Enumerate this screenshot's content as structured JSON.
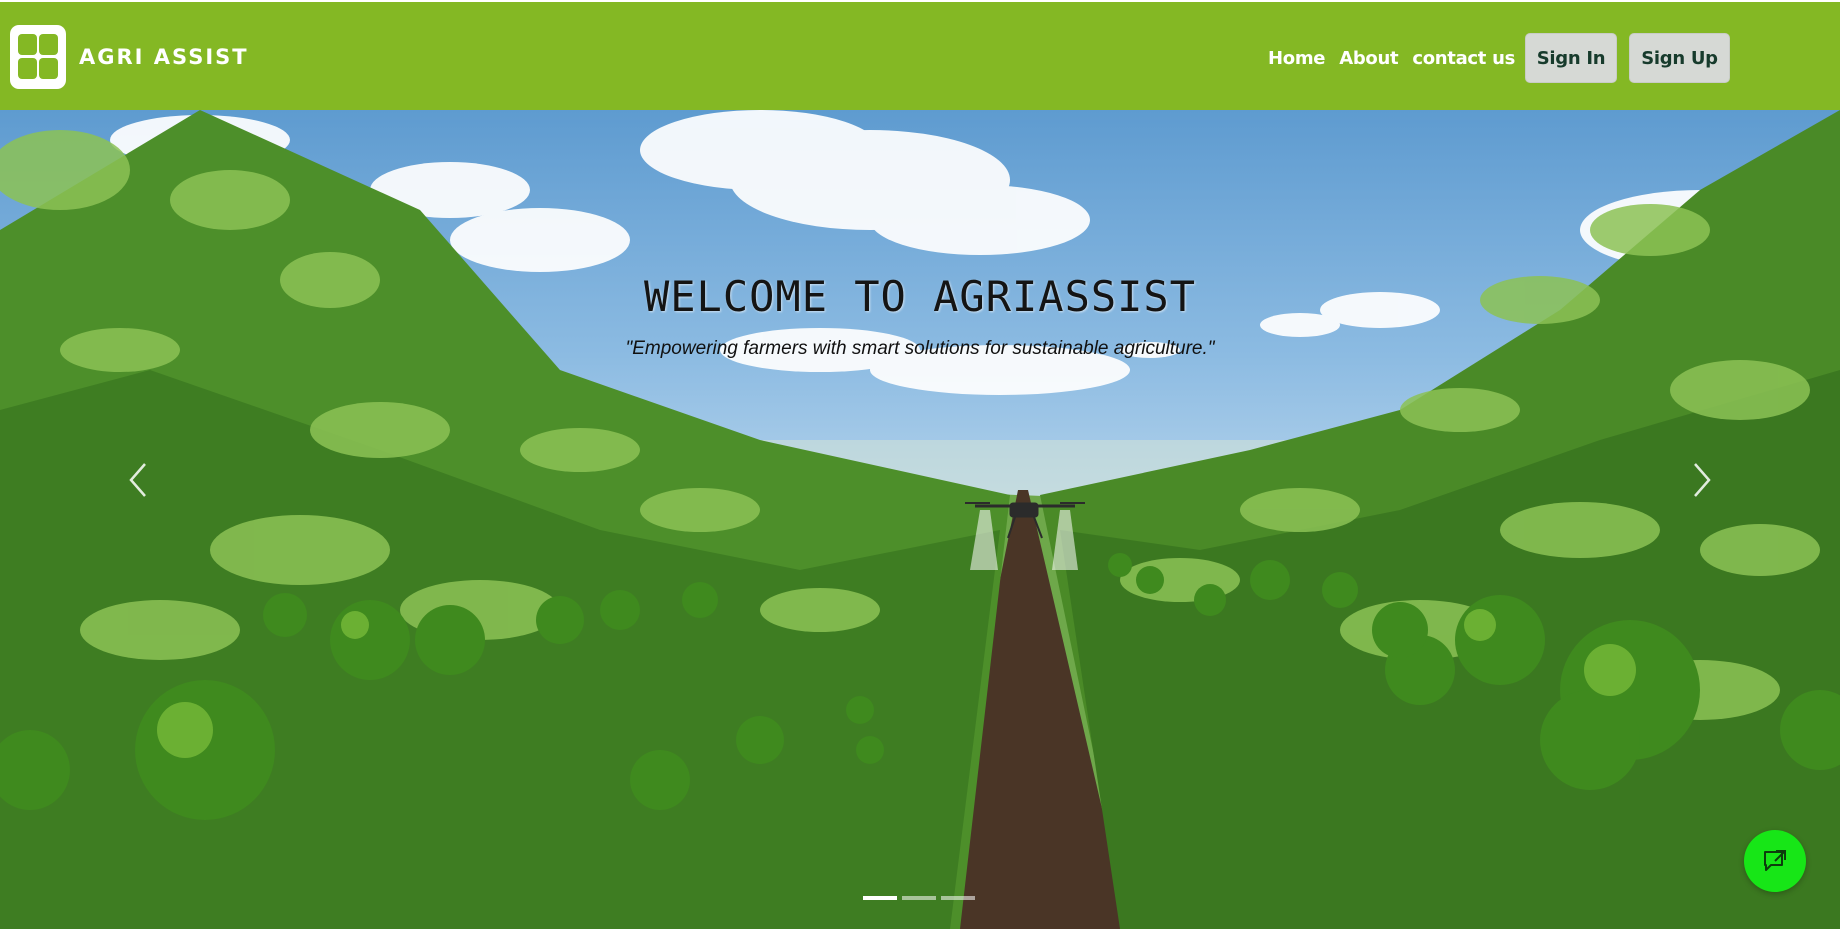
{
  "navbar": {
    "brand_name": "AGRI ASSIST",
    "links": [
      {
        "label": "Home"
      },
      {
        "label": "About"
      },
      {
        "label": "contact us"
      }
    ],
    "sign_in_label": "Sign In",
    "sign_up_label": "Sign Up",
    "background_color": "#84b824"
  },
  "hero": {
    "title": "WELCOME TO AGRIASSIST",
    "subtitle": "\"Empowering farmers with smart solutions for sustainable agriculture.\"",
    "slide_count": 3,
    "active_slide": 1,
    "prev_icon": "chevron-left-icon",
    "next_icon": "chevron-right-icon"
  },
  "chat_fab": {
    "icon": "chat-icon",
    "color": "#17e617"
  }
}
